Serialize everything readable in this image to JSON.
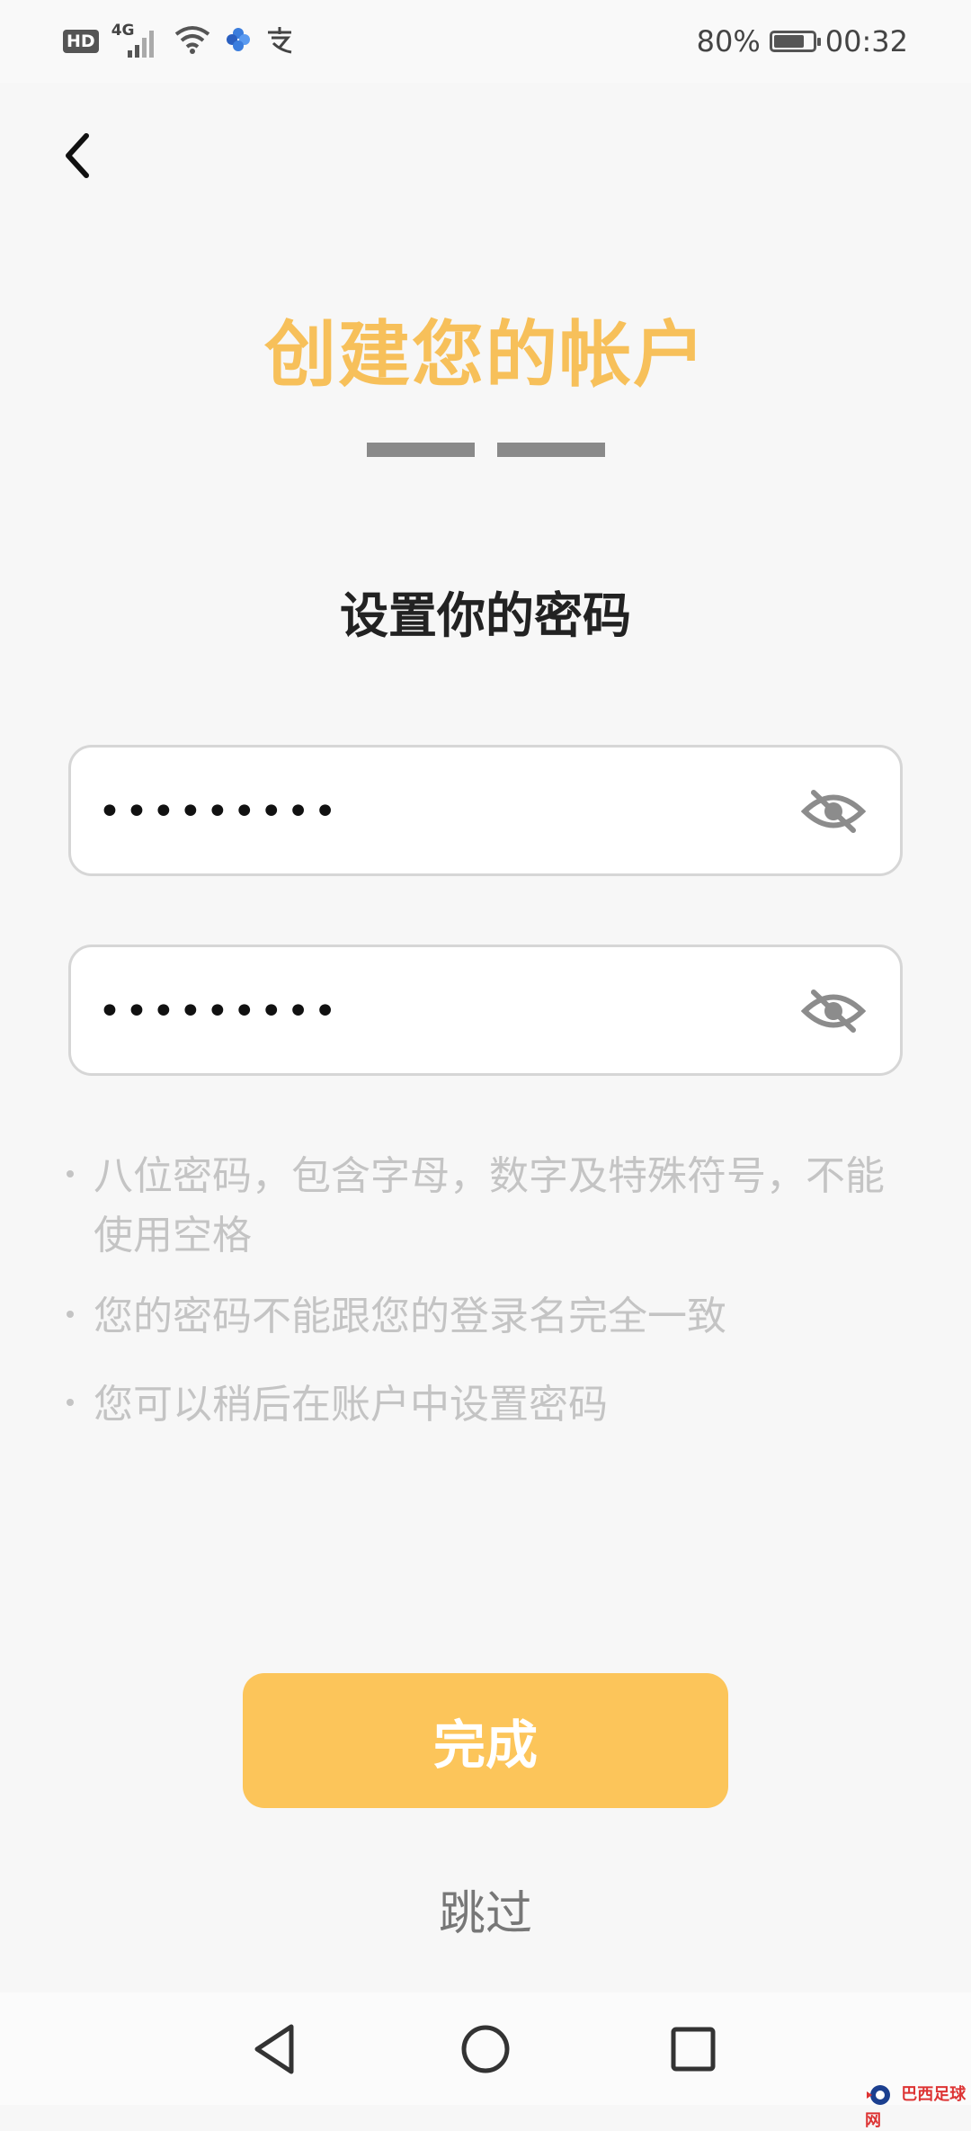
{
  "status_bar": {
    "hd_badge": "HD",
    "network_type": "4G",
    "battery_percent": "80%",
    "battery_level": 0.8,
    "time": "00:32"
  },
  "header": {
    "title": "创建您的帐户",
    "subtitle": "设置你的密码",
    "steps_total": 2
  },
  "fields": [
    {
      "value": "•••••••••",
      "toggle_icon": "eye-off-icon"
    },
    {
      "value": "•••••••••",
      "toggle_icon": "eye-off-icon"
    }
  ],
  "hints": [
    "八位密码，包含字母，数字及特殊符号，不能使用空格",
    "您的密码不能跟您的登录名完全一致",
    "您可以稍后在账户中设置密码"
  ],
  "actions": {
    "done_label": "完成",
    "skip_label": "跳过"
  },
  "watermark": "巴西足球网",
  "colors": {
    "accent": "#fcc55a",
    "title": "#f7c05a",
    "hint": "#c4c4c4",
    "step_indicator": "#8a8a8a"
  }
}
